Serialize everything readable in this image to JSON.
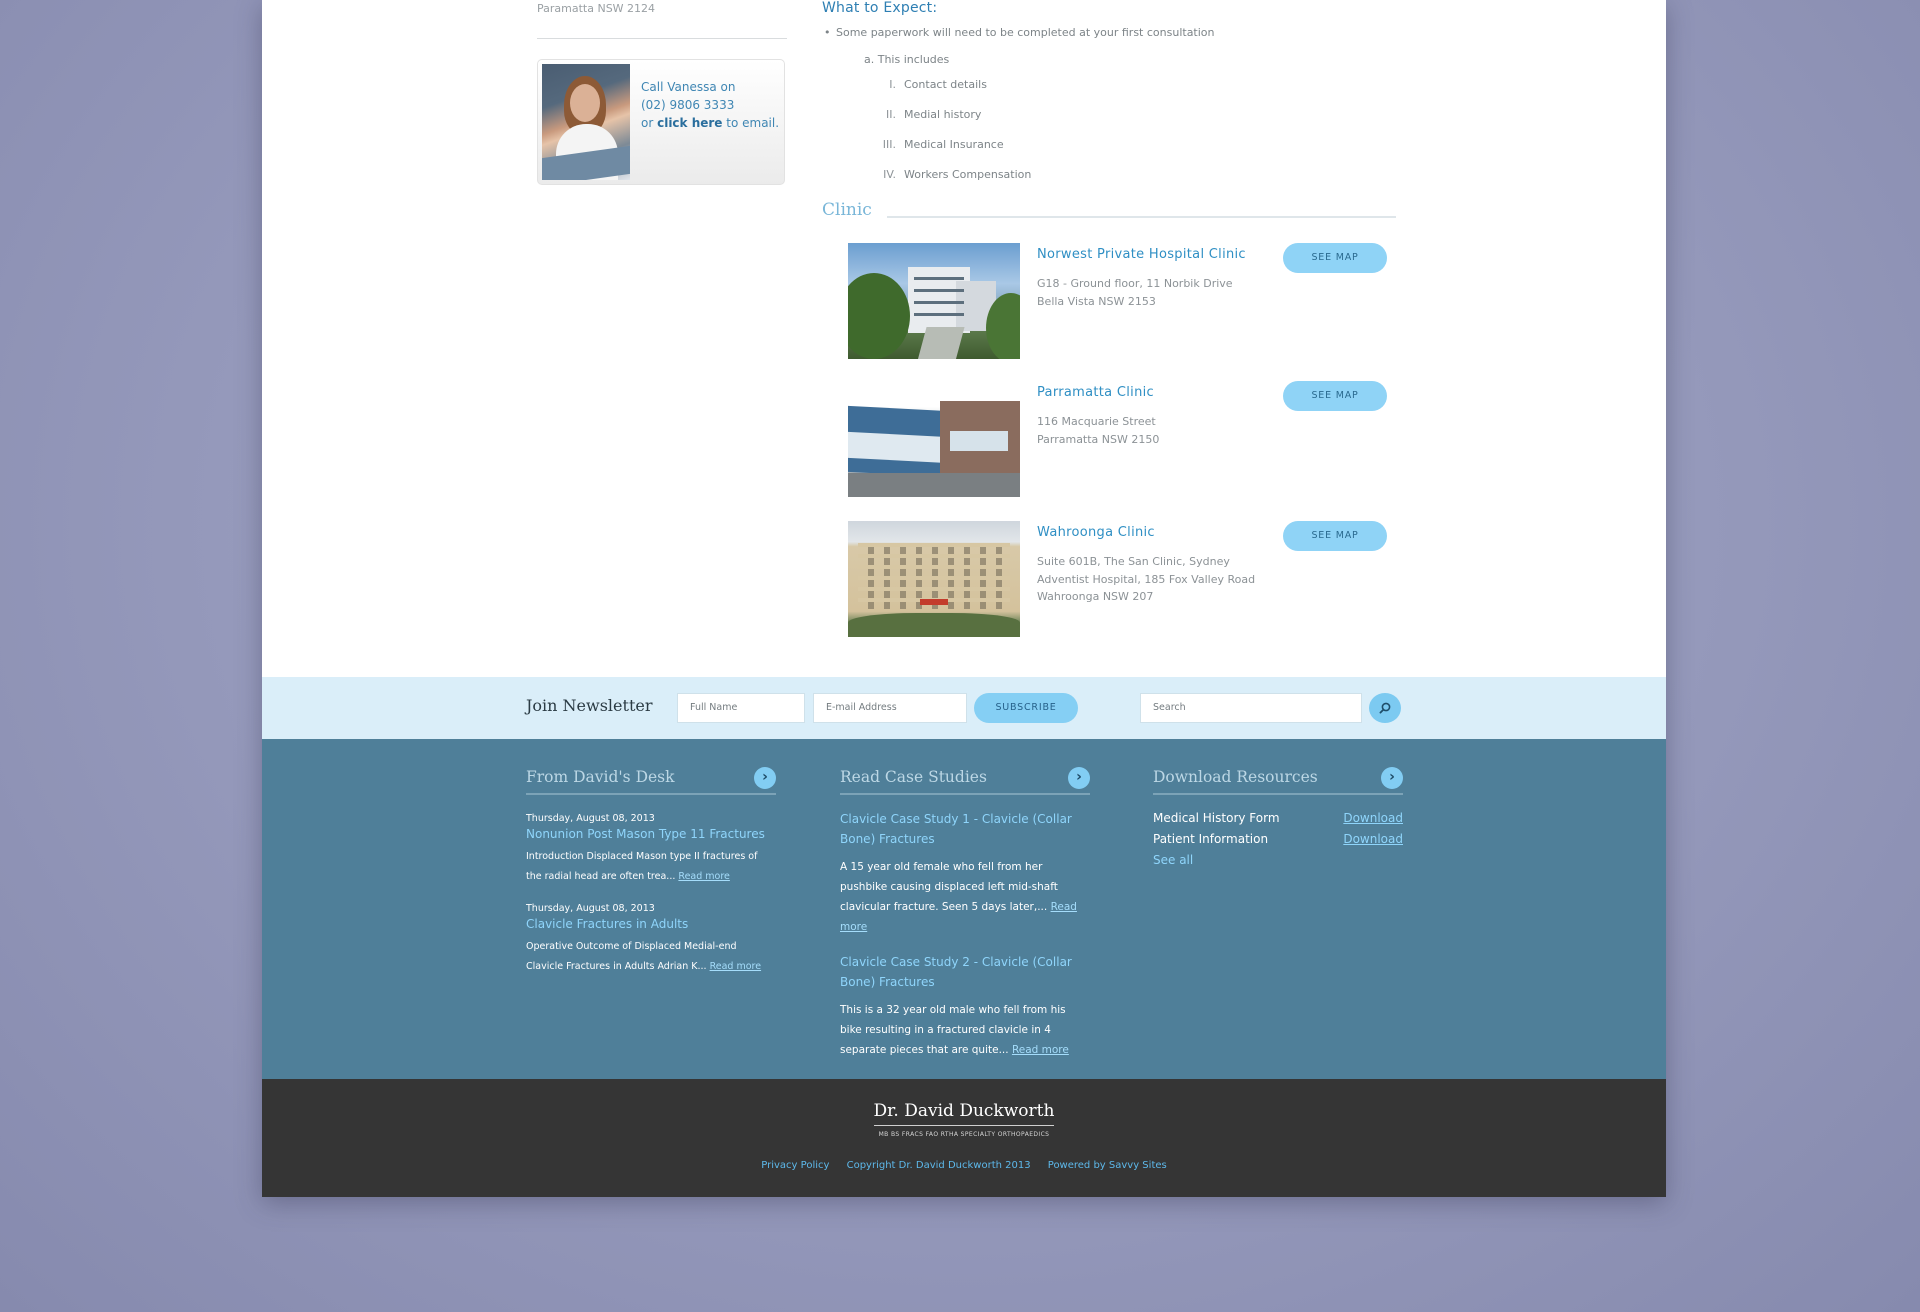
{
  "sidebar": {
    "address_tail": "Paramatta NSW 2124",
    "contact": {
      "line1": "Call Vanessa on",
      "phone": "(02) 9806 3333",
      "prefix": "or ",
      "link": "click here",
      "suffix": " to email."
    }
  },
  "expect": {
    "title": "What to Expect:",
    "bullet": "Some paperwork will need to be completed at your first consultation",
    "sub": "a.  This includes",
    "items": [
      {
        "num": "I.",
        "text": "Contact details"
      },
      {
        "num": "II.",
        "text": "Medial history"
      },
      {
        "num": "III.",
        "text": "Medical Insurance"
      },
      {
        "num": "IV.",
        "text": "Workers Compensation"
      }
    ]
  },
  "clinics": {
    "heading": "Clinic",
    "see_map": "SEE MAP",
    "items": [
      {
        "name": "Norwest Private Hospital Clinic",
        "addr1": "G18 - Ground floor, 11 Norbik Drive",
        "addr2": "Bella Vista NSW 2153"
      },
      {
        "name": "Parramatta Clinic",
        "addr1": "116 Macquarie Street",
        "addr2": "Parramatta NSW 2150"
      },
      {
        "name": "Wahroonga Clinic",
        "addr1": "Suite 601B, The San Clinic, Sydney Adventist Hospital, 185 Fox Valley Road",
        "addr2": "Wahroonga NSW 207"
      }
    ]
  },
  "newsletter": {
    "title": "Join Newsletter",
    "name_placeholder": "Full Name",
    "email_placeholder": "E-mail Address",
    "subscribe": "SUBSCRIBE",
    "search_placeholder": "Search"
  },
  "desk": {
    "title": "From David's Desk",
    "posts": [
      {
        "date": "Thursday, August 08, 2013",
        "title": "Nonunion Post Mason Type 11 Fractures",
        "excerpt": "Introduction Displaced Mason type II fractures of the radial head are often trea...",
        "more": "Read more"
      },
      {
        "date": "Thursday, August 08, 2013",
        "title": "Clavicle Fractures in Adults",
        "excerpt": "Operative Outcome of Displaced Medial-end Clavicle Fractures in Adults Adrian K...",
        "more": "Read more"
      }
    ]
  },
  "cases": {
    "title": "Read Case Studies",
    "items": [
      {
        "title": "Clavicle Case Study 1 - Clavicle (Collar Bone) Fractures",
        "excerpt": "A 15 year old female who fell from her pushbike causing displaced left mid-shaft clavicular fracture. Seen 5 days later,...",
        "more": "Read more"
      },
      {
        "title": "Clavicle Case Study 2 - Clavicle (Collar Bone) Fractures",
        "excerpt": "This is a 32 year old male who fell from his bike resulting in a fractured clavicle in 4 separate pieces that are quite...",
        "more": "Read more"
      }
    ]
  },
  "resources": {
    "title": "Download Resources",
    "items": [
      {
        "label": "Medical History Form",
        "link": "Download"
      },
      {
        "label": "Patient Information",
        "link": "Download"
      }
    ],
    "see_all": "See all"
  },
  "footer": {
    "brand": "Dr. David Duckworth",
    "credentials": "MB BS FRACS FAO RTHA      SPECIALTY ORTHOPAEDICS",
    "links": [
      "Privacy Policy",
      "Copyright Dr. David Duckworth 2013",
      "Powered by Savvy Sites"
    ]
  },
  "colors": {
    "accent": "#2f8fc4",
    "button": "#8fd3f6",
    "footer_blue": "#4f7f99",
    "footer_dark": "#353535"
  }
}
